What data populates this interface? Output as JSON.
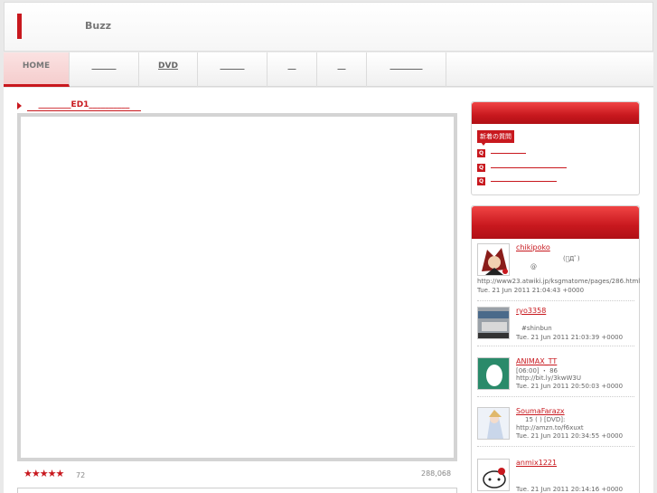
{
  "header": {
    "logo_text": "Buzz"
  },
  "nav": {
    "items": [
      {
        "label": "HOME"
      },
      {
        "label": "______"
      },
      {
        "label": "DVD"
      },
      {
        "label": "______"
      },
      {
        "label": "__"
      },
      {
        "label": "__"
      },
      {
        "label": "________"
      }
    ]
  },
  "main": {
    "title": "________ED1__________",
    "stars": "★★★★★",
    "rating_count": "72",
    "view_count": "288,068"
  },
  "sidebar": {
    "questions_badge": "新着の質問",
    "questions": [
      {
        "icon": "Q"
      },
      {
        "icon": "Q"
      },
      {
        "icon": "Q"
      }
    ],
    "tweets": [
      {
        "user": "chikipoko",
        "line1": "(ﾟДﾟ)",
        "line2": "@",
        "link": "http://www23.atwiki.jp/ksgmatome/pages/286.html",
        "time": "Tue. 21 Jun 2011 21:04:43 +0000"
      },
      {
        "user": "ryo3358",
        "line1": "#shinbun",
        "time": "Tue. 21 Jun 2011 21:03:39 +0000"
      },
      {
        "user": "ANIMAX_TT",
        "line1": "[06:00]          ・ 86",
        "link": "http://bit.ly/3kwW3U",
        "time": "Tue. 21 Jun 2011 20:50:03 +0000"
      },
      {
        "user": "SoumaFarazx",
        "line1": "15              ( ) [DVD]:",
        "link": "http://amzn.to/f6xuxt",
        "time": "Tue. 21 Jun 2011 20:34:55 +0000"
      },
      {
        "user": "anmix1221",
        "time": "Tue. 21 Jun 2011 20:14:16 +0000"
      }
    ]
  },
  "colors": {
    "accent": "#c8181e",
    "border": "#d4d4d4"
  }
}
